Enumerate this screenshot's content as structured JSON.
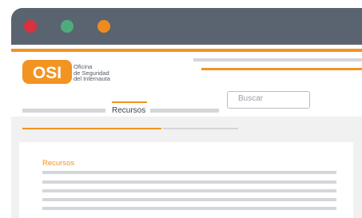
{
  "window": {
    "controls": [
      {
        "name": "close",
        "color": "#d9313f"
      },
      {
        "name": "minimize",
        "color": "#4eac7c"
      },
      {
        "name": "maximize",
        "color": "#ef8a1f"
      }
    ]
  },
  "brand": {
    "logo": "OSI",
    "name_lines": [
      "Oficina",
      "de Seguridad",
      "del Internauta"
    ],
    "accent": "#f39321",
    "titlebar": "#5a6471"
  },
  "nav": {
    "active_label": "Recursos"
  },
  "search": {
    "placeholder": "Buscar"
  },
  "card": {
    "title": "Recursos"
  }
}
